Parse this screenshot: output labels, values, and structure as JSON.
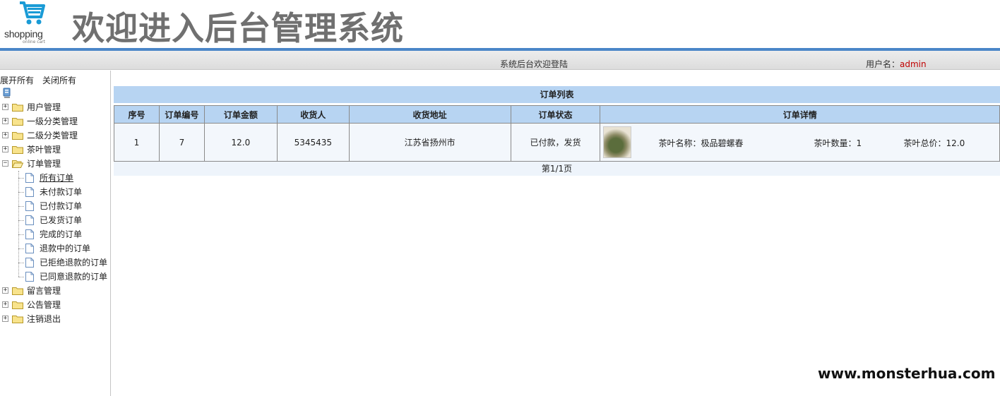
{
  "logo": {
    "text": "shopping",
    "subtext": "online cart",
    "icon": "shopping-cart-icon"
  },
  "header": {
    "title": "欢迎进入后台管理系统"
  },
  "topbar": {
    "welcome": "系统后台欢迎登陆",
    "user_label": "用户名：",
    "user_name": "admin"
  },
  "sidebar": {
    "expand_all": "展开所有",
    "collapse_all": "关闭所有",
    "root_icon": "server-icon",
    "nodes": [
      {
        "label": "用户管理",
        "expanded": false
      },
      {
        "label": "一级分类管理",
        "expanded": false
      },
      {
        "label": "二级分类管理",
        "expanded": false
      },
      {
        "label": "茶叶管理",
        "expanded": false
      },
      {
        "label": "订单管理",
        "expanded": true
      },
      {
        "label": "留言管理",
        "expanded": false
      },
      {
        "label": "公告管理",
        "expanded": false
      },
      {
        "label": "注销退出",
        "expanded": false
      }
    ],
    "order_children": [
      "所有订单",
      "未付款订单",
      "已付款订单",
      "已发货订单",
      "完成的订单",
      "退款中的订单",
      "已拒绝退款的订单",
      "已同意退款的订单"
    ]
  },
  "orders": {
    "title": "订单列表",
    "columns": [
      "序号",
      "订单编号",
      "订单金额",
      "收货人",
      "收货地址",
      "订单状态",
      "订单详情"
    ],
    "rows": [
      {
        "index": "1",
        "order_no": "7",
        "amount": "12.0",
        "receiver": "5345435",
        "address": "江苏省扬州市",
        "status": "已付款，发货",
        "detail": {
          "name": "茶叶名称：极品碧螺春",
          "qty": "茶叶数量：1",
          "total": "茶叶总价：12.0"
        }
      }
    ],
    "pager": "第1/1页"
  },
  "watermark": "www.monsterhua.com",
  "colors": {
    "header_bar": "#4b86c8",
    "table_header": "#b7d4f2",
    "user_name": "#c00000",
    "title": "#707070"
  }
}
